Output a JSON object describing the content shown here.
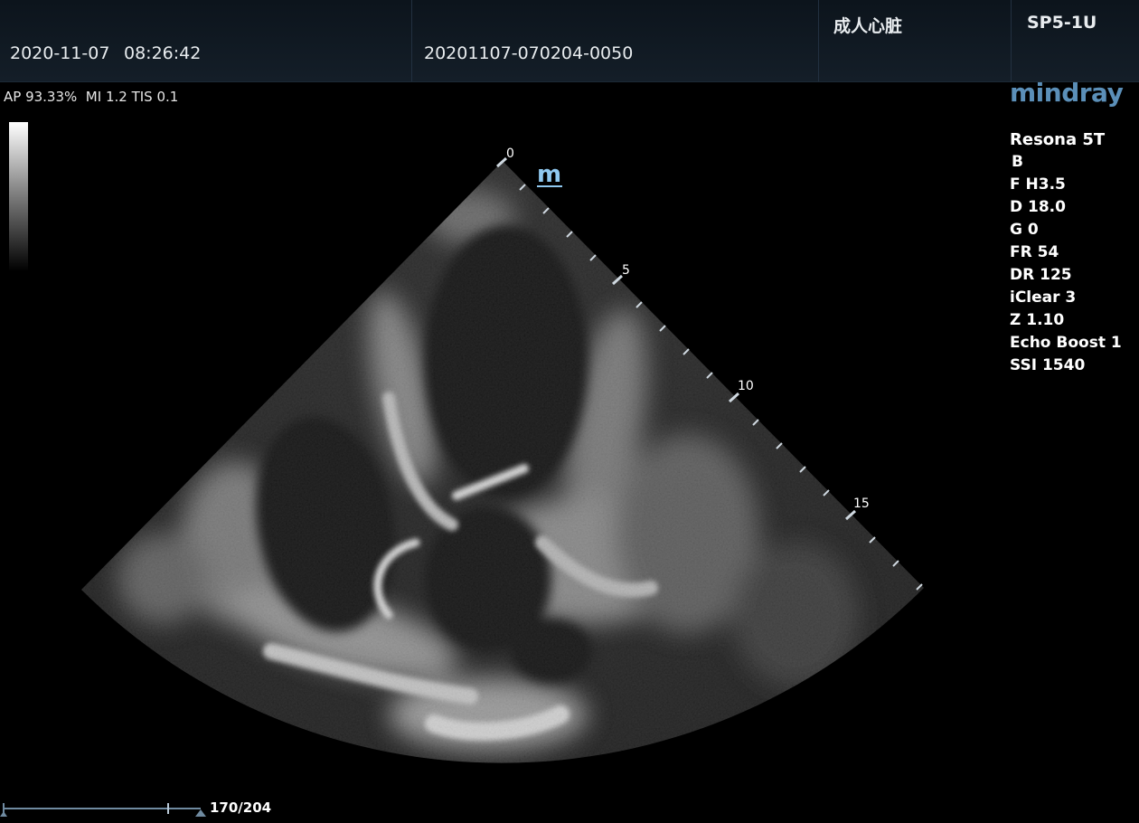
{
  "header": {
    "date": "2020-11-07",
    "time": "08:26:42",
    "patient_id": "20201107-070204-0050",
    "exam_preset": "成人心脏",
    "probe": "SP5-1U"
  },
  "acoustic_output": "AP 93.33%  MI 1.2 TIS 0.1",
  "brand": "mindray",
  "image_params": {
    "model": "Resona 5T",
    "mode": "B",
    "frequency": "F H3.5",
    "depth": "D 18.0",
    "gain": "G 0",
    "frame_rate": "FR 54",
    "dynamic_range": "DR 125",
    "iclear": "iClear 3",
    "zoom": "Z 1.10",
    "echo_boost": "Echo Boost 1",
    "ssi": "SSI 1540"
  },
  "depth_scale": {
    "labels": [
      "0",
      "5",
      "10",
      "15"
    ]
  },
  "orientation_marker": "m",
  "cine": {
    "frame_counter": "170/204"
  },
  "colors": {
    "header_bg": "#111b24",
    "brand_blue": "#5b8fb8",
    "marker_blue": "#8fc8f0"
  }
}
